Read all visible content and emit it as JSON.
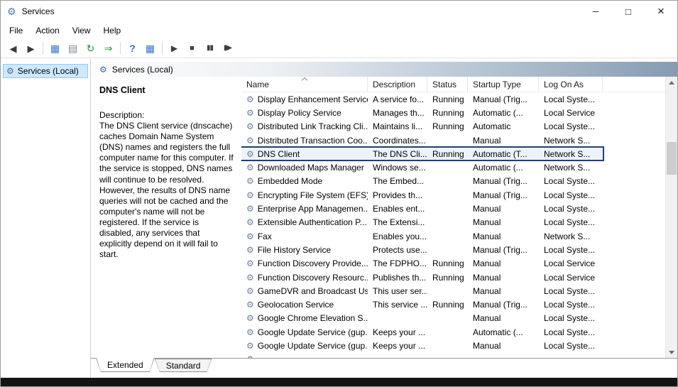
{
  "window": {
    "title": "Services",
    "controls": {
      "minimize": "─",
      "maximize": "□",
      "close": "×"
    }
  },
  "menubar": {
    "items": [
      "File",
      "Action",
      "View",
      "Help"
    ]
  },
  "toolbar": {
    "items": [
      {
        "name": "back",
        "glyph": "◀",
        "color": "#3a3a3a"
      },
      {
        "name": "forward",
        "glyph": "▶",
        "color": "#3a3a3a"
      },
      {
        "sep": true
      },
      {
        "name": "show-console-tree",
        "glyph": "▦",
        "color": "#2e77c9"
      },
      {
        "name": "properties",
        "glyph": "▤",
        "color": "#7a8591"
      },
      {
        "name": "refresh",
        "glyph": "↻",
        "color": "#1f8f3a"
      },
      {
        "name": "export-list",
        "glyph": "⇒",
        "color": "#1f8f3a"
      },
      {
        "sep": true
      },
      {
        "name": "help",
        "glyph": "?",
        "color": "#2f6fd0"
      },
      {
        "name": "show-action-pane",
        "glyph": "▦",
        "color": "#2e77c9"
      },
      {
        "sep": true
      },
      {
        "name": "start-service",
        "glyph": "▶",
        "color": "#3f3f3f"
      },
      {
        "name": "stop-service",
        "glyph": "■",
        "color": "#3f3f3f"
      },
      {
        "name": "pause-service",
        "glyph": "▮▮",
        "color": "#3f3f3f"
      },
      {
        "name": "restart-service",
        "glyph": "▮▶",
        "color": "#3f3f3f"
      }
    ]
  },
  "sidebar": {
    "items": [
      {
        "label": "Services (Local)",
        "icon": "⚙",
        "selected": true
      }
    ]
  },
  "main": {
    "banner": {
      "label": "Services (Local)",
      "icon": "⚙"
    },
    "detail": {
      "title": "DNS Client",
      "description_label": "Description:",
      "description": "The DNS Client service (dnscache) caches Domain Name System (DNS) names and registers the full computer name for this computer. If the service is stopped, DNS names will continue to be resolved. However, the results of DNS name queries will not be cached and the computer's name will not be registered. If the service is disabled, any services that explicitly depend on it will fail to start."
    },
    "table": {
      "columns": [
        "Name",
        "Description",
        "Status",
        "Startup Type",
        "Log On As"
      ],
      "sorted_column_index": 0,
      "row_icon_glyph": "⚙",
      "rows": [
        {
          "name": "Display Enhancement Service",
          "description": "A service fo...",
          "status": "Running",
          "startup_type": "Manual (Trig...",
          "log_on_as": "Local Syste...",
          "selected": false
        },
        {
          "name": "Display Policy Service",
          "description": "Manages th...",
          "status": "Running",
          "startup_type": "Automatic (...",
          "log_on_as": "Local Service",
          "selected": false
        },
        {
          "name": "Distributed Link Tracking Cli...",
          "description": "Maintains li...",
          "status": "Running",
          "startup_type": "Automatic",
          "log_on_as": "Local Syste...",
          "selected": false
        },
        {
          "name": "Distributed Transaction Coo...",
          "description": "Coordinates...",
          "status": "",
          "startup_type": "Manual",
          "log_on_as": "Network S...",
          "selected": false
        },
        {
          "name": "DNS Client",
          "description": "The DNS Cli...",
          "status": "Running",
          "startup_type": "Automatic (T...",
          "log_on_as": "Network S...",
          "selected": true
        },
        {
          "name": "Downloaded Maps Manager",
          "description": "Windows se...",
          "status": "",
          "startup_type": "Automatic (...",
          "log_on_as": "Network S...",
          "selected": false
        },
        {
          "name": "Embedded Mode",
          "description": "The Embed...",
          "status": "",
          "startup_type": "Manual (Trig...",
          "log_on_as": "Local Syste...",
          "selected": false
        },
        {
          "name": "Encrypting File System (EFS)",
          "description": "Provides th...",
          "status": "",
          "startup_type": "Manual (Trig...",
          "log_on_as": "Local Syste...",
          "selected": false
        },
        {
          "name": "Enterprise App Managemen...",
          "description": "Enables ent...",
          "status": "",
          "startup_type": "Manual",
          "log_on_as": "Local Syste...",
          "selected": false
        },
        {
          "name": "Extensible Authentication P...",
          "description": "The Extensi...",
          "status": "",
          "startup_type": "Manual",
          "log_on_as": "Local Syste...",
          "selected": false
        },
        {
          "name": "Fax",
          "description": "Enables you...",
          "status": "",
          "startup_type": "Manual",
          "log_on_as": "Network S...",
          "selected": false
        },
        {
          "name": "File History Service",
          "description": "Protects use...",
          "status": "",
          "startup_type": "Manual (Trig...",
          "log_on_as": "Local Syste...",
          "selected": false
        },
        {
          "name": "Function Discovery Provide...",
          "description": "The FDPHO...",
          "status": "Running",
          "startup_type": "Manual",
          "log_on_as": "Local Service",
          "selected": false
        },
        {
          "name": "Function Discovery Resourc...",
          "description": "Publishes th...",
          "status": "Running",
          "startup_type": "Manual",
          "log_on_as": "Local Service",
          "selected": false
        },
        {
          "name": "GameDVR and Broadcast Us...",
          "description": "This user ser...",
          "status": "",
          "startup_type": "Manual",
          "log_on_as": "Local Syste...",
          "selected": false
        },
        {
          "name": "Geolocation Service",
          "description": "This service ...",
          "status": "Running",
          "startup_type": "Manual (Trig...",
          "log_on_as": "Local Syste...",
          "selected": false
        },
        {
          "name": "Google Chrome Elevation S...",
          "description": "",
          "status": "",
          "startup_type": "Manual",
          "log_on_as": "Local Syste...",
          "selected": false
        },
        {
          "name": "Google Update Service (gup...",
          "description": "Keeps your ...",
          "status": "",
          "startup_type": "Automatic (...",
          "log_on_as": "Local Syste...",
          "selected": false
        },
        {
          "name": "Google Update Service (gup...",
          "description": "Keeps your ...",
          "status": "",
          "startup_type": "Manual",
          "log_on_as": "Local Syste...",
          "selected": false
        },
        {
          "name": "",
          "description": "",
          "status": "",
          "startup_type": "",
          "log_on_as": "",
          "selected": false
        }
      ]
    },
    "tabs": [
      {
        "label": "Extended",
        "active": true
      },
      {
        "label": "Standard",
        "active": false
      }
    ]
  }
}
